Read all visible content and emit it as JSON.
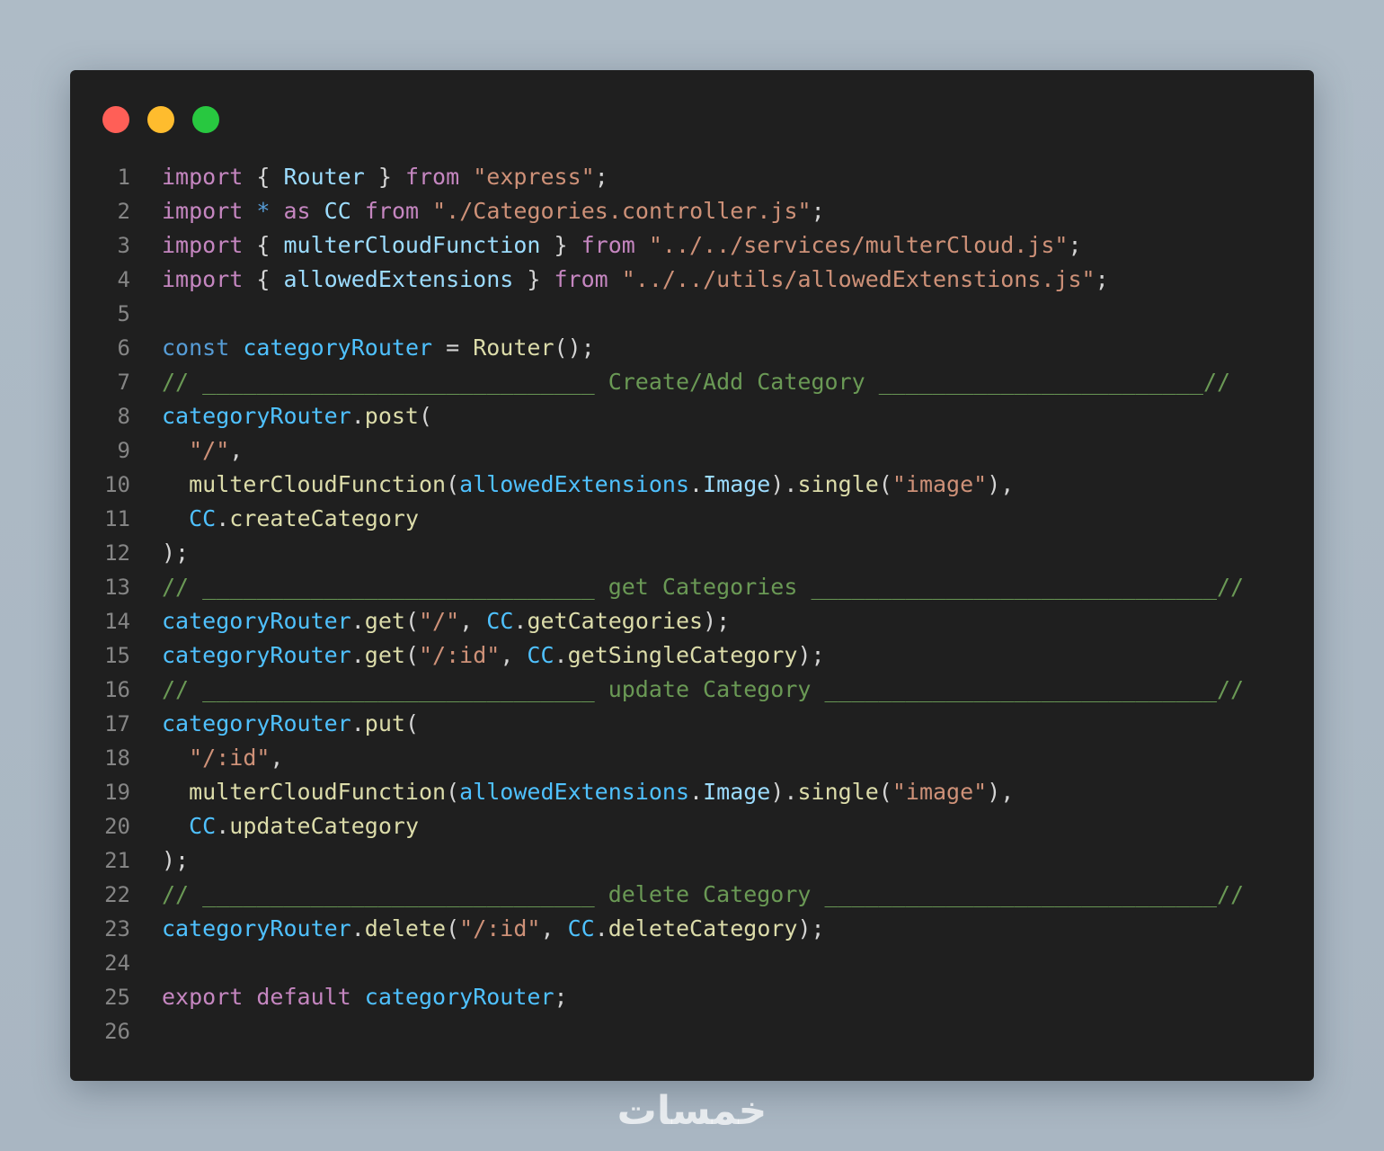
{
  "window_controls": {
    "close_color": "#ff5f57",
    "minimize_color": "#febc2e",
    "maximize_color": "#28c840"
  },
  "code": {
    "language": "javascript",
    "lines": [
      {
        "n": "1",
        "tokens": [
          {
            "t": "import",
            "c": "keyword"
          },
          {
            "t": " { ",
            "c": "punct"
          },
          {
            "t": "Router",
            "c": "variable"
          },
          {
            "t": " } ",
            "c": "punct"
          },
          {
            "t": "from",
            "c": "keyword"
          },
          {
            "t": " ",
            "c": "punct"
          },
          {
            "t": "\"express\"",
            "c": "string"
          },
          {
            "t": ";",
            "c": "punct"
          }
        ]
      },
      {
        "n": "2",
        "tokens": [
          {
            "t": "import",
            "c": "keyword"
          },
          {
            "t": " ",
            "c": "punct"
          },
          {
            "t": "*",
            "c": "storage"
          },
          {
            "t": " ",
            "c": "punct"
          },
          {
            "t": "as",
            "c": "keyword"
          },
          {
            "t": " ",
            "c": "punct"
          },
          {
            "t": "CC",
            "c": "variable"
          },
          {
            "t": " ",
            "c": "punct"
          },
          {
            "t": "from",
            "c": "keyword"
          },
          {
            "t": " ",
            "c": "punct"
          },
          {
            "t": "\"./Categories.controller.js\"",
            "c": "string"
          },
          {
            "t": ";",
            "c": "punct"
          }
        ]
      },
      {
        "n": "3",
        "tokens": [
          {
            "t": "import",
            "c": "keyword"
          },
          {
            "t": " { ",
            "c": "punct"
          },
          {
            "t": "multerCloudFunction",
            "c": "variable"
          },
          {
            "t": " } ",
            "c": "punct"
          },
          {
            "t": "from",
            "c": "keyword"
          },
          {
            "t": " ",
            "c": "punct"
          },
          {
            "t": "\"../../services/multerCloud.js\"",
            "c": "string"
          },
          {
            "t": ";",
            "c": "punct"
          }
        ]
      },
      {
        "n": "4",
        "tokens": [
          {
            "t": "import",
            "c": "keyword"
          },
          {
            "t": " { ",
            "c": "punct"
          },
          {
            "t": "allowedExtensions",
            "c": "variable"
          },
          {
            "t": " } ",
            "c": "punct"
          },
          {
            "t": "from",
            "c": "keyword"
          },
          {
            "t": " ",
            "c": "punct"
          },
          {
            "t": "\"../../utils/allowedExtenstions.js\"",
            "c": "string"
          },
          {
            "t": ";",
            "c": "punct"
          }
        ]
      },
      {
        "n": "5",
        "tokens": []
      },
      {
        "n": "6",
        "tokens": [
          {
            "t": "const",
            "c": "storage"
          },
          {
            "t": " ",
            "c": "punct"
          },
          {
            "t": "categoryRouter",
            "c": "constant"
          },
          {
            "t": " = ",
            "c": "punct"
          },
          {
            "t": "Router",
            "c": "function"
          },
          {
            "t": "();",
            "c": "punct"
          }
        ]
      },
      {
        "n": "7",
        "tokens": [
          {
            "t": "// _____________________________ Create/Add Category ________________________//",
            "c": "comment"
          }
        ]
      },
      {
        "n": "8",
        "tokens": [
          {
            "t": "categoryRouter",
            "c": "constant"
          },
          {
            "t": ".",
            "c": "punct"
          },
          {
            "t": "post",
            "c": "function"
          },
          {
            "t": "(",
            "c": "punct"
          }
        ]
      },
      {
        "n": "9",
        "tokens": [
          {
            "t": "  ",
            "c": "punct"
          },
          {
            "t": "\"/\"",
            "c": "string"
          },
          {
            "t": ",",
            "c": "punct"
          }
        ]
      },
      {
        "n": "10",
        "tokens": [
          {
            "t": "  ",
            "c": "punct"
          },
          {
            "t": "multerCloudFunction",
            "c": "function"
          },
          {
            "t": "(",
            "c": "punct"
          },
          {
            "t": "allowedExtensions",
            "c": "constant"
          },
          {
            "t": ".",
            "c": "punct"
          },
          {
            "t": "Image",
            "c": "variable"
          },
          {
            "t": ").",
            "c": "punct"
          },
          {
            "t": "single",
            "c": "function"
          },
          {
            "t": "(",
            "c": "punct"
          },
          {
            "t": "\"image\"",
            "c": "string"
          },
          {
            "t": "),",
            "c": "punct"
          }
        ]
      },
      {
        "n": "11",
        "tokens": [
          {
            "t": "  ",
            "c": "punct"
          },
          {
            "t": "CC",
            "c": "constant"
          },
          {
            "t": ".",
            "c": "punct"
          },
          {
            "t": "createCategory",
            "c": "function"
          }
        ]
      },
      {
        "n": "12",
        "tokens": [
          {
            "t": ");",
            "c": "punct"
          }
        ]
      },
      {
        "n": "13",
        "tokens": [
          {
            "t": "// _____________________________ get Categories ______________________________//",
            "c": "comment"
          }
        ]
      },
      {
        "n": "14",
        "tokens": [
          {
            "t": "categoryRouter",
            "c": "constant"
          },
          {
            "t": ".",
            "c": "punct"
          },
          {
            "t": "get",
            "c": "function"
          },
          {
            "t": "(",
            "c": "punct"
          },
          {
            "t": "\"/\"",
            "c": "string"
          },
          {
            "t": ", ",
            "c": "punct"
          },
          {
            "t": "CC",
            "c": "constant"
          },
          {
            "t": ".",
            "c": "punct"
          },
          {
            "t": "getCategories",
            "c": "function"
          },
          {
            "t": ");",
            "c": "punct"
          }
        ]
      },
      {
        "n": "15",
        "tokens": [
          {
            "t": "categoryRouter",
            "c": "constant"
          },
          {
            "t": ".",
            "c": "punct"
          },
          {
            "t": "get",
            "c": "function"
          },
          {
            "t": "(",
            "c": "punct"
          },
          {
            "t": "\"/:id\"",
            "c": "string"
          },
          {
            "t": ", ",
            "c": "punct"
          },
          {
            "t": "CC",
            "c": "constant"
          },
          {
            "t": ".",
            "c": "punct"
          },
          {
            "t": "getSingleCategory",
            "c": "function"
          },
          {
            "t": ");",
            "c": "punct"
          }
        ]
      },
      {
        "n": "16",
        "tokens": [
          {
            "t": "// _____________________________ update Category _____________________________//",
            "c": "comment"
          }
        ]
      },
      {
        "n": "17",
        "tokens": [
          {
            "t": "categoryRouter",
            "c": "constant"
          },
          {
            "t": ".",
            "c": "punct"
          },
          {
            "t": "put",
            "c": "function"
          },
          {
            "t": "(",
            "c": "punct"
          }
        ]
      },
      {
        "n": "18",
        "tokens": [
          {
            "t": "  ",
            "c": "punct"
          },
          {
            "t": "\"/:id\"",
            "c": "string"
          },
          {
            "t": ",",
            "c": "punct"
          }
        ]
      },
      {
        "n": "19",
        "tokens": [
          {
            "t": "  ",
            "c": "punct"
          },
          {
            "t": "multerCloudFunction",
            "c": "function"
          },
          {
            "t": "(",
            "c": "punct"
          },
          {
            "t": "allowedExtensions",
            "c": "constant"
          },
          {
            "t": ".",
            "c": "punct"
          },
          {
            "t": "Image",
            "c": "variable"
          },
          {
            "t": ").",
            "c": "punct"
          },
          {
            "t": "single",
            "c": "function"
          },
          {
            "t": "(",
            "c": "punct"
          },
          {
            "t": "\"image\"",
            "c": "string"
          },
          {
            "t": "),",
            "c": "punct"
          }
        ]
      },
      {
        "n": "20",
        "tokens": [
          {
            "t": "  ",
            "c": "punct"
          },
          {
            "t": "CC",
            "c": "constant"
          },
          {
            "t": ".",
            "c": "punct"
          },
          {
            "t": "updateCategory",
            "c": "function"
          }
        ]
      },
      {
        "n": "21",
        "tokens": [
          {
            "t": ");",
            "c": "punct"
          }
        ]
      },
      {
        "n": "22",
        "tokens": [
          {
            "t": "// _____________________________ delete Category _____________________________//",
            "c": "comment"
          }
        ]
      },
      {
        "n": "23",
        "tokens": [
          {
            "t": "categoryRouter",
            "c": "constant"
          },
          {
            "t": ".",
            "c": "punct"
          },
          {
            "t": "delete",
            "c": "function"
          },
          {
            "t": "(",
            "c": "punct"
          },
          {
            "t": "\"/:id\"",
            "c": "string"
          },
          {
            "t": ", ",
            "c": "punct"
          },
          {
            "t": "CC",
            "c": "constant"
          },
          {
            "t": ".",
            "c": "punct"
          },
          {
            "t": "deleteCategory",
            "c": "function"
          },
          {
            "t": ");",
            "c": "punct"
          }
        ]
      },
      {
        "n": "24",
        "tokens": []
      },
      {
        "n": "25",
        "tokens": [
          {
            "t": "export",
            "c": "keyword"
          },
          {
            "t": " ",
            "c": "punct"
          },
          {
            "t": "default",
            "c": "keyword"
          },
          {
            "t": " ",
            "c": "punct"
          },
          {
            "t": "categoryRouter",
            "c": "constant"
          },
          {
            "t": ";",
            "c": "punct"
          }
        ]
      },
      {
        "n": "26",
        "tokens": []
      }
    ]
  },
  "watermark": {
    "text": "خمسات"
  }
}
